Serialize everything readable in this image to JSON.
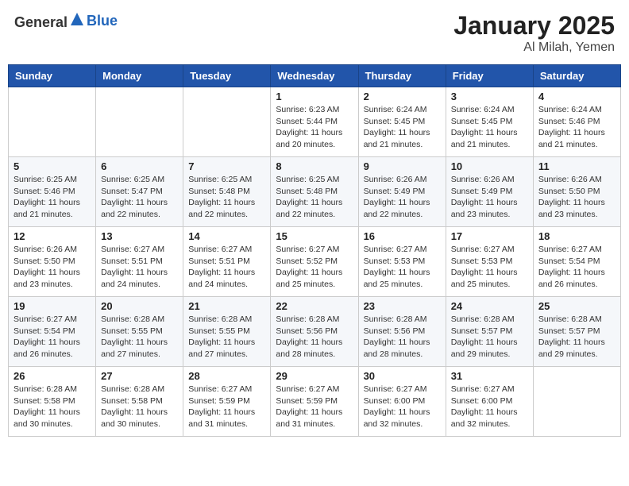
{
  "header": {
    "logo_general": "General",
    "logo_blue": "Blue",
    "month": "January 2025",
    "location": "Al Milah, Yemen"
  },
  "days_of_week": [
    "Sunday",
    "Monday",
    "Tuesday",
    "Wednesday",
    "Thursday",
    "Friday",
    "Saturday"
  ],
  "weeks": [
    [
      {
        "day": "",
        "sunrise": "",
        "sunset": "",
        "daylight": ""
      },
      {
        "day": "",
        "sunrise": "",
        "sunset": "",
        "daylight": ""
      },
      {
        "day": "",
        "sunrise": "",
        "sunset": "",
        "daylight": ""
      },
      {
        "day": "1",
        "sunrise": "Sunrise: 6:23 AM",
        "sunset": "Sunset: 5:44 PM",
        "daylight": "Daylight: 11 hours and 20 minutes."
      },
      {
        "day": "2",
        "sunrise": "Sunrise: 6:24 AM",
        "sunset": "Sunset: 5:45 PM",
        "daylight": "Daylight: 11 hours and 21 minutes."
      },
      {
        "day": "3",
        "sunrise": "Sunrise: 6:24 AM",
        "sunset": "Sunset: 5:45 PM",
        "daylight": "Daylight: 11 hours and 21 minutes."
      },
      {
        "day": "4",
        "sunrise": "Sunrise: 6:24 AM",
        "sunset": "Sunset: 5:46 PM",
        "daylight": "Daylight: 11 hours and 21 minutes."
      }
    ],
    [
      {
        "day": "5",
        "sunrise": "Sunrise: 6:25 AM",
        "sunset": "Sunset: 5:46 PM",
        "daylight": "Daylight: 11 hours and 21 minutes."
      },
      {
        "day": "6",
        "sunrise": "Sunrise: 6:25 AM",
        "sunset": "Sunset: 5:47 PM",
        "daylight": "Daylight: 11 hours and 22 minutes."
      },
      {
        "day": "7",
        "sunrise": "Sunrise: 6:25 AM",
        "sunset": "Sunset: 5:48 PM",
        "daylight": "Daylight: 11 hours and 22 minutes."
      },
      {
        "day": "8",
        "sunrise": "Sunrise: 6:25 AM",
        "sunset": "Sunset: 5:48 PM",
        "daylight": "Daylight: 11 hours and 22 minutes."
      },
      {
        "day": "9",
        "sunrise": "Sunrise: 6:26 AM",
        "sunset": "Sunset: 5:49 PM",
        "daylight": "Daylight: 11 hours and 22 minutes."
      },
      {
        "day": "10",
        "sunrise": "Sunrise: 6:26 AM",
        "sunset": "Sunset: 5:49 PM",
        "daylight": "Daylight: 11 hours and 23 minutes."
      },
      {
        "day": "11",
        "sunrise": "Sunrise: 6:26 AM",
        "sunset": "Sunset: 5:50 PM",
        "daylight": "Daylight: 11 hours and 23 minutes."
      }
    ],
    [
      {
        "day": "12",
        "sunrise": "Sunrise: 6:26 AM",
        "sunset": "Sunset: 5:50 PM",
        "daylight": "Daylight: 11 hours and 23 minutes."
      },
      {
        "day": "13",
        "sunrise": "Sunrise: 6:27 AM",
        "sunset": "Sunset: 5:51 PM",
        "daylight": "Daylight: 11 hours and 24 minutes."
      },
      {
        "day": "14",
        "sunrise": "Sunrise: 6:27 AM",
        "sunset": "Sunset: 5:51 PM",
        "daylight": "Daylight: 11 hours and 24 minutes."
      },
      {
        "day": "15",
        "sunrise": "Sunrise: 6:27 AM",
        "sunset": "Sunset: 5:52 PM",
        "daylight": "Daylight: 11 hours and 25 minutes."
      },
      {
        "day": "16",
        "sunrise": "Sunrise: 6:27 AM",
        "sunset": "Sunset: 5:53 PM",
        "daylight": "Daylight: 11 hours and 25 minutes."
      },
      {
        "day": "17",
        "sunrise": "Sunrise: 6:27 AM",
        "sunset": "Sunset: 5:53 PM",
        "daylight": "Daylight: 11 hours and 25 minutes."
      },
      {
        "day": "18",
        "sunrise": "Sunrise: 6:27 AM",
        "sunset": "Sunset: 5:54 PM",
        "daylight": "Daylight: 11 hours and 26 minutes."
      }
    ],
    [
      {
        "day": "19",
        "sunrise": "Sunrise: 6:27 AM",
        "sunset": "Sunset: 5:54 PM",
        "daylight": "Daylight: 11 hours and 26 minutes."
      },
      {
        "day": "20",
        "sunrise": "Sunrise: 6:28 AM",
        "sunset": "Sunset: 5:55 PM",
        "daylight": "Daylight: 11 hours and 27 minutes."
      },
      {
        "day": "21",
        "sunrise": "Sunrise: 6:28 AM",
        "sunset": "Sunset: 5:55 PM",
        "daylight": "Daylight: 11 hours and 27 minutes."
      },
      {
        "day": "22",
        "sunrise": "Sunrise: 6:28 AM",
        "sunset": "Sunset: 5:56 PM",
        "daylight": "Daylight: 11 hours and 28 minutes."
      },
      {
        "day": "23",
        "sunrise": "Sunrise: 6:28 AM",
        "sunset": "Sunset: 5:56 PM",
        "daylight": "Daylight: 11 hours and 28 minutes."
      },
      {
        "day": "24",
        "sunrise": "Sunrise: 6:28 AM",
        "sunset": "Sunset: 5:57 PM",
        "daylight": "Daylight: 11 hours and 29 minutes."
      },
      {
        "day": "25",
        "sunrise": "Sunrise: 6:28 AM",
        "sunset": "Sunset: 5:57 PM",
        "daylight": "Daylight: 11 hours and 29 minutes."
      }
    ],
    [
      {
        "day": "26",
        "sunrise": "Sunrise: 6:28 AM",
        "sunset": "Sunset: 5:58 PM",
        "daylight": "Daylight: 11 hours and 30 minutes."
      },
      {
        "day": "27",
        "sunrise": "Sunrise: 6:28 AM",
        "sunset": "Sunset: 5:58 PM",
        "daylight": "Daylight: 11 hours and 30 minutes."
      },
      {
        "day": "28",
        "sunrise": "Sunrise: 6:27 AM",
        "sunset": "Sunset: 5:59 PM",
        "daylight": "Daylight: 11 hours and 31 minutes."
      },
      {
        "day": "29",
        "sunrise": "Sunrise: 6:27 AM",
        "sunset": "Sunset: 5:59 PM",
        "daylight": "Daylight: 11 hours and 31 minutes."
      },
      {
        "day": "30",
        "sunrise": "Sunrise: 6:27 AM",
        "sunset": "Sunset: 6:00 PM",
        "daylight": "Daylight: 11 hours and 32 minutes."
      },
      {
        "day": "31",
        "sunrise": "Sunrise: 6:27 AM",
        "sunset": "Sunset: 6:00 PM",
        "daylight": "Daylight: 11 hours and 32 minutes."
      },
      {
        "day": "",
        "sunrise": "",
        "sunset": "",
        "daylight": ""
      }
    ]
  ]
}
